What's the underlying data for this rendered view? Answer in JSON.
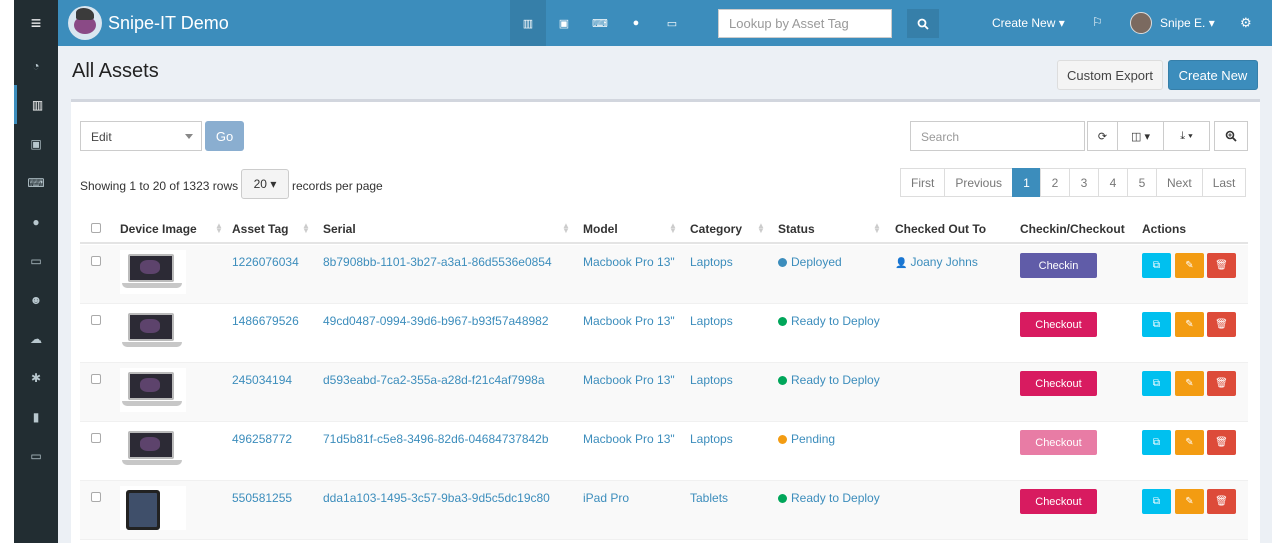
{
  "colors": {
    "brand": "#3c8dbc",
    "sidebar": "#222d32",
    "checkin": "#605ca8",
    "checkout": "#d81b60",
    "checkout_disabled": "#e87ca5",
    "deployed": "#3c8dbc",
    "ready": "#00a65a",
    "pending": "#f39c12",
    "clone": "#00c0ef",
    "edit": "#f39c12",
    "delete": "#dd4b39"
  },
  "sidebar": {
    "menu_icon": "hamburger-icon",
    "items": [
      {
        "icon": "dashboard-icon"
      },
      {
        "icon": "barcode-icon",
        "active": true
      },
      {
        "icon": "save-icon"
      },
      {
        "icon": "keyboard-icon"
      },
      {
        "icon": "tint-icon"
      },
      {
        "icon": "hdd-icon"
      },
      {
        "icon": "users-icon"
      },
      {
        "icon": "cloud-download-icon"
      },
      {
        "icon": "cog-icon"
      },
      {
        "icon": "chart-icon"
      },
      {
        "icon": "laptop-icon"
      }
    ]
  },
  "topbar": {
    "brand": "Snipe-IT Demo",
    "lookup_placeholder": "Lookup by Asset Tag",
    "create_new": "Create New",
    "user": "Snipe E."
  },
  "header": {
    "title": "All Assets",
    "custom_export": "Custom Export",
    "create_new": "Create New"
  },
  "toolbar": {
    "bulk_action": "Edit",
    "go": "Go",
    "search_placeholder": "Search"
  },
  "pagination": {
    "showing": "Showing 1 to 20 of 1323 rows",
    "per_page": "20",
    "records_per_page": "records per page",
    "pages": [
      "First",
      "Previous",
      "1",
      "2",
      "3",
      "4",
      "5",
      "Next",
      "Last"
    ],
    "active": "1"
  },
  "table": {
    "headers": {
      "device_image": "Device Image",
      "asset_tag": "Asset Tag",
      "serial": "Serial",
      "model": "Model",
      "category": "Category",
      "status": "Status",
      "checked_out_to": "Checked Out To",
      "checkin_checkout": "Checkin/Checkout",
      "actions": "Actions"
    },
    "rows": [
      {
        "image": "laptop",
        "asset_tag": "1226076034",
        "serial": "8b7908bb-1101-3b27-a3a1-86d5536e0854",
        "model": "Macbook Pro 13\"",
        "category": "Laptops",
        "status": "Deployed",
        "status_color": "#3c8dbc",
        "checked_out_to": "Joany Johns",
        "action": "Checkin",
        "action_color": "#605ca8"
      },
      {
        "image": "laptop",
        "asset_tag": "1486679526",
        "serial": "49cd0487-0994-39d6-b967-b93f57a48982",
        "model": "Macbook Pro 13\"",
        "category": "Laptops",
        "status": "Ready to Deploy",
        "status_color": "#00a65a",
        "checked_out_to": "",
        "action": "Checkout",
        "action_color": "#d81b60"
      },
      {
        "image": "laptop",
        "asset_tag": "245034194",
        "serial": "d593eabd-7ca2-355a-a28d-f21c4af7998a",
        "model": "Macbook Pro 13\"",
        "category": "Laptops",
        "status": "Ready to Deploy",
        "status_color": "#00a65a",
        "checked_out_to": "",
        "action": "Checkout",
        "action_color": "#d81b60"
      },
      {
        "image": "laptop",
        "asset_tag": "496258772",
        "serial": "71d5b81f-c5e8-3496-82d6-04684737842b",
        "model": "Macbook Pro 13\"",
        "category": "Laptops",
        "status": "Pending",
        "status_color": "#f39c12",
        "checked_out_to": "",
        "action": "Checkout",
        "action_color": "#e87ca5"
      },
      {
        "image": "tablet",
        "asset_tag": "550581255",
        "serial": "dda1a103-1495-3c57-9ba3-9d5c5dc19c80",
        "model": "iPad Pro",
        "category": "Tablets",
        "status": "Ready to Deploy",
        "status_color": "#00a65a",
        "checked_out_to": "",
        "action": "Checkout",
        "action_color": "#d81b60"
      }
    ]
  }
}
